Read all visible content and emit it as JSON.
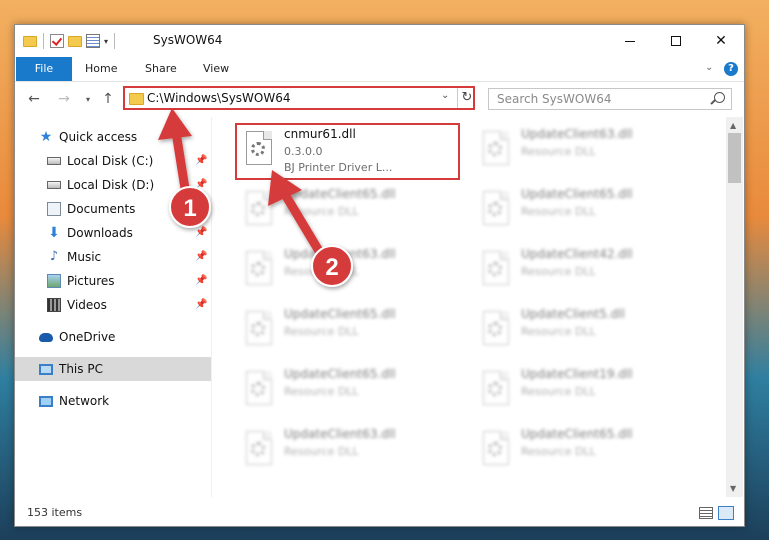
{
  "window": {
    "title": "SysWOW64"
  },
  "ribbon": {
    "tabs": [
      "File",
      "Home",
      "Share",
      "View"
    ]
  },
  "address": {
    "path": "C:\\Windows\\SysWOW64"
  },
  "search": {
    "placeholder": "Search SysWOW64"
  },
  "nav": {
    "items": [
      {
        "label": "Quick access",
        "icon": "star-icon"
      },
      {
        "label": "Local Disk (C:)",
        "icon": "drive-icon"
      },
      {
        "label": "Local Disk (D:)",
        "icon": "drive-icon"
      },
      {
        "label": "Documents",
        "icon": "documents-icon"
      },
      {
        "label": "Downloads",
        "icon": "download-icon"
      },
      {
        "label": "Music",
        "icon": "music-icon"
      },
      {
        "label": "Pictures",
        "icon": "pictures-icon"
      },
      {
        "label": "Videos",
        "icon": "videos-icon"
      },
      {
        "label": "OneDrive",
        "icon": "cloud-icon"
      },
      {
        "label": "This PC",
        "icon": "computer-icon"
      },
      {
        "label": "Network",
        "icon": "network-icon"
      }
    ]
  },
  "files": [
    {
      "name": "cnmur61.dll",
      "line2": "0.3.0.0",
      "line3": "BJ Printer Driver L..."
    },
    {
      "name": "UpdateClient63.dll",
      "line2": "Resource DLL"
    },
    {
      "name": "UpdateClient65.dll",
      "line2": "Resource DLL"
    },
    {
      "name": "UpdateClient65.dll",
      "line2": "Resource DLL"
    },
    {
      "name": "UpdateClient63.dll",
      "line2": "Resource DLL"
    },
    {
      "name": "UpdateClient42.dll",
      "line2": "Resource DLL"
    },
    {
      "name": "UpdateClient65.dll",
      "line2": "Resource DLL"
    },
    {
      "name": "UpdateClient5.dll",
      "line2": "Resource DLL"
    },
    {
      "name": "UpdateClient65.dll",
      "line2": "Resource DLL"
    },
    {
      "name": "UpdateClient19.dll",
      "line2": "Resource DLL"
    },
    {
      "name": "UpdateClient63.dll",
      "line2": "Resource DLL"
    },
    {
      "name": "UpdateClient65.dll",
      "line2": "Resource DLL"
    }
  ],
  "status": {
    "item_count": "153 items"
  },
  "annotations": {
    "step1": "1",
    "step2": "2",
    "color": "#d63b3b"
  }
}
